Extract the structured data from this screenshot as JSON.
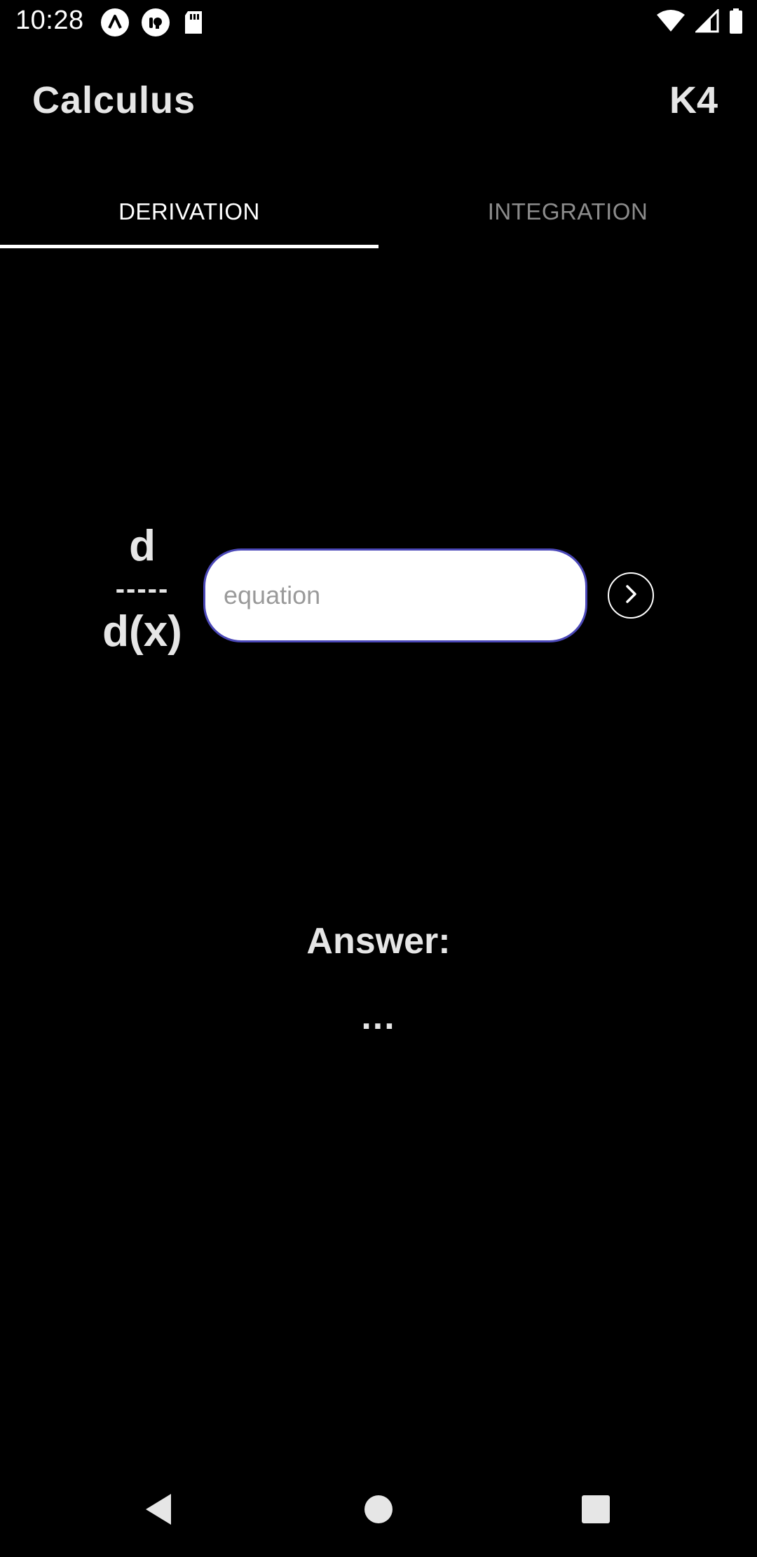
{
  "status_bar": {
    "time": "10:28",
    "left_icons": [
      "app-notification-icon-a",
      "app-notification-icon-b",
      "sd-card-icon"
    ],
    "right_icons": [
      "wifi-icon",
      "cellular-signal-icon",
      "battery-icon"
    ]
  },
  "app_bar": {
    "title": "Calculus",
    "user_label": "K4"
  },
  "tabs": [
    {
      "label": "DERIVATION",
      "active": true
    },
    {
      "label": "INTEGRATION",
      "active": false
    }
  ],
  "derivation": {
    "operator_numerator": "d",
    "operator_line": "-----",
    "operator_denominator": "d(x)",
    "input_placeholder": "equation",
    "input_value": "",
    "submit_icon": "chevron-right-icon"
  },
  "answer": {
    "label": "Answer:",
    "value": "..."
  },
  "nav_bar": {
    "icons": [
      "back-icon",
      "home-icon",
      "recents-icon"
    ]
  },
  "colors": {
    "background": "#000000",
    "text_primary": "#e6e6e6",
    "tab_inactive": "#8c8c8c",
    "input_border": "#4b48b8",
    "input_background": "#ffffff"
  }
}
